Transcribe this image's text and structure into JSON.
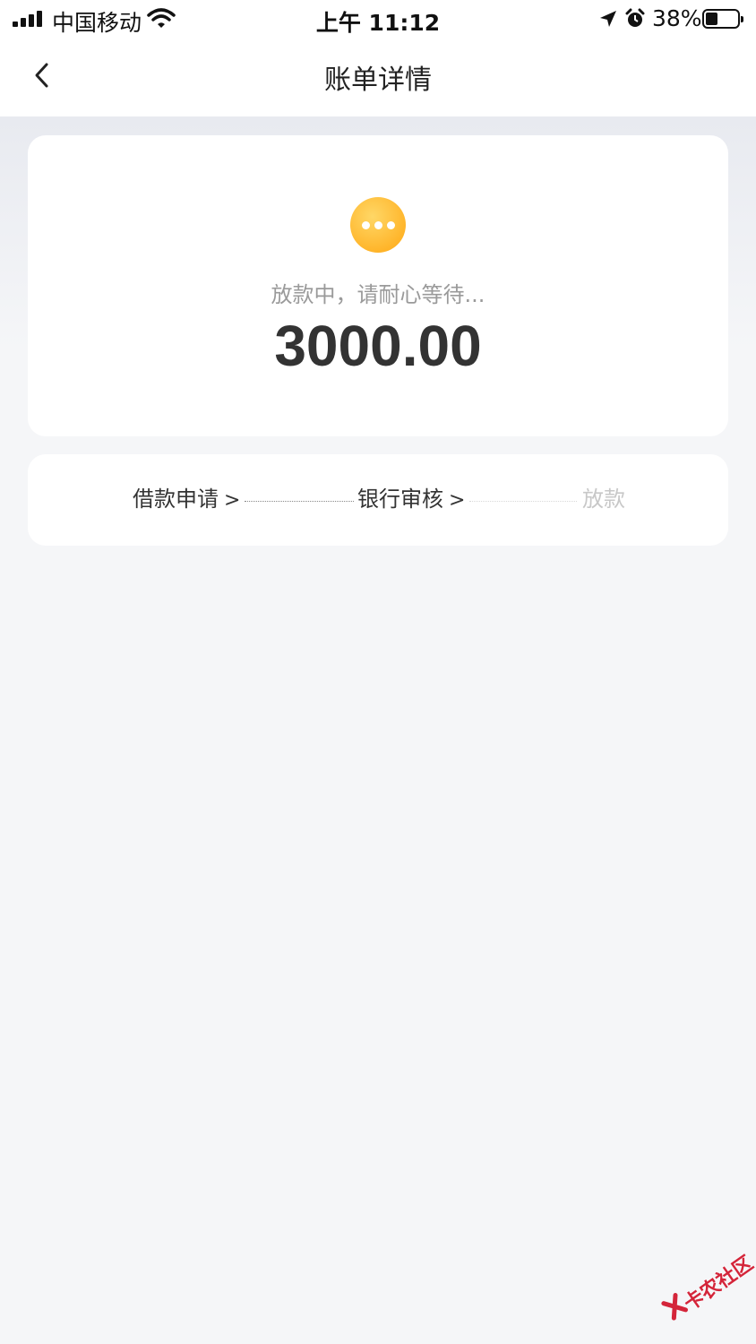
{
  "status_bar": {
    "carrier": "中国移动",
    "time": "上午 11:12",
    "battery_pct": "38%",
    "battery_level": 0.38,
    "icons": [
      "signal-icon",
      "wifi-icon",
      "location-icon",
      "alarm-icon",
      "battery-icon"
    ]
  },
  "nav": {
    "back_icon": "chevron-left-icon",
    "title": "账单详情"
  },
  "status_card": {
    "icon": "more-dots-icon",
    "icon_color": "#ffb327",
    "message": "放款中，请耐心等待...",
    "amount": "3000.00"
  },
  "progress": {
    "steps": [
      {
        "label": "借款申请",
        "arrow": ">",
        "state": "done"
      },
      {
        "label": "银行审核",
        "arrow": ">",
        "state": "done"
      },
      {
        "label": "放款",
        "arrow": "",
        "state": "pending"
      }
    ]
  },
  "watermark": {
    "text": "卡农社区",
    "color": "#d4253a"
  }
}
